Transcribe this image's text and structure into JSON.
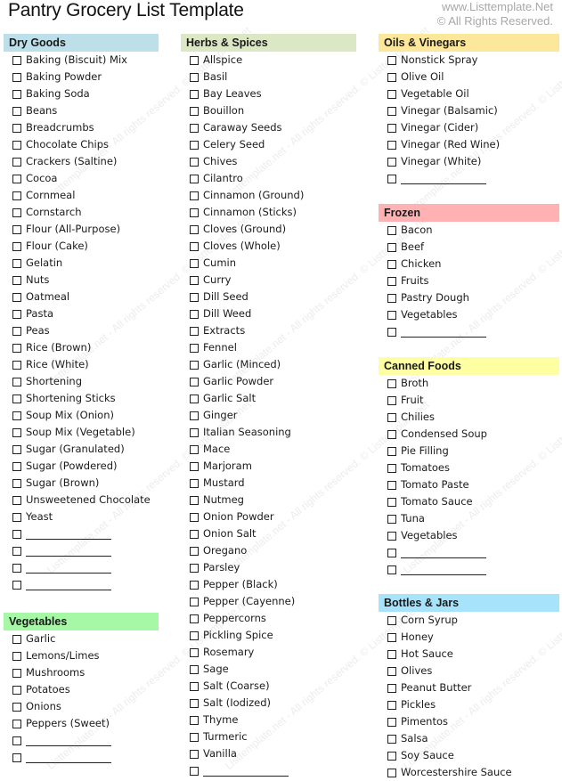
{
  "title": "Pantry Grocery List Template",
  "brand": {
    "site": "www.Listtemplate.Net",
    "copyright": "© All Rights Reserved."
  },
  "watermark_text": "Listtemplate.net - All rights reserved. © Listtemplate.net",
  "colors": {
    "dry_goods": "#bddfea",
    "herbs_spices": "#dce7c5",
    "oils_vinegars": "#fde79a",
    "frozen": "#ffb1b4",
    "canned_foods": "#fefea2",
    "vegetables": "#a6f7a6",
    "bottles_jars": "#a7e3fa"
  },
  "sections": {
    "dry_goods": {
      "title": "Dry Goods",
      "items": [
        "Baking (Biscuit) Mix",
        "Baking Powder",
        "Baking Soda",
        "Beans",
        "Breadcrumbs",
        "Chocolate Chips",
        "Crackers (Saltine)",
        "Cocoa",
        "Cornmeal",
        "Cornstarch",
        "Flour (All-Purpose)",
        "Flour (Cake)",
        "Gelatin",
        "Nuts",
        "Oatmeal",
        "Pasta",
        "Peas",
        "Rice (Brown)",
        "Rice (White)",
        "Shortening",
        "Shortening Sticks",
        "Soup Mix (Onion)",
        "Soup Mix (Vegetable)",
        "Sugar (Granulated)",
        "Sugar (Powdered)",
        "Sugar (Brown)",
        "Unsweetened Chocolate",
        "Yeast",
        "",
        "",
        "",
        ""
      ]
    },
    "vegetables": {
      "title": "Vegetables",
      "items": [
        "Garlic",
        "Lemons/Limes",
        "Mushrooms",
        "Potatoes",
        "Onions",
        "Peppers (Sweet)",
        "",
        ""
      ]
    },
    "herbs_spices": {
      "title": "Herbs & Spices",
      "items": [
        "Allspice",
        "Basil",
        "Bay Leaves",
        "Bouillon",
        "Caraway Seeds",
        "Celery Seed",
        "Chives",
        "Cilantro",
        "Cinnamon (Ground)",
        "Cinnamon (Sticks)",
        "Cloves (Ground)",
        "Cloves (Whole)",
        "Cumin",
        "Curry",
        "Dill Seed",
        "Dill Weed",
        "Extracts",
        "Fennel",
        "Garlic (Minced)",
        "Garlic Powder",
        "Garlic Salt",
        "Ginger",
        "Italian Seasoning",
        "Mace",
        "Marjoram",
        "Mustard",
        "Nutmeg",
        "Onion Powder",
        "Onion Salt",
        "Oregano",
        "Parsley",
        "Pepper (Black)",
        "Pepper (Cayenne)",
        "Peppercorns",
        "Pickling Spice",
        "Rosemary",
        "Sage",
        "Salt (Coarse)",
        "Salt (Iodized)",
        "Thyme",
        "Turmeric",
        "Vanilla",
        ""
      ]
    },
    "oils_vinegars": {
      "title": "Oils & Vinegars",
      "items": [
        "Nonstick Spray",
        "Olive Oil",
        "Vegetable Oil",
        "Vinegar (Balsamic)",
        "Vinegar (Cider)",
        "Vinegar (Red Wine)",
        "Vinegar (White)",
        ""
      ]
    },
    "frozen": {
      "title": "Frozen",
      "items": [
        "Bacon",
        "Beef",
        "Chicken",
        "Fruits",
        "Pastry Dough",
        "Vegetables",
        ""
      ]
    },
    "canned_foods": {
      "title": "Canned Foods",
      "items": [
        "Broth",
        "Fruit",
        "Chilies",
        "Condensed Soup",
        "Pie Filling",
        "Tomatoes",
        "Tomato Paste",
        "Tomato Sauce",
        "Tuna",
        "Vegetables",
        "",
        ""
      ]
    },
    "bottles_jars": {
      "title": "Bottles & Jars",
      "items": [
        "Corn Syrup",
        "Honey",
        "Hot Sauce",
        "Olives",
        "Peanut Butter",
        "Pickles",
        "Pimentos",
        "Salsa",
        "Soy Sauce",
        "Worcestershire Sauce"
      ]
    }
  }
}
